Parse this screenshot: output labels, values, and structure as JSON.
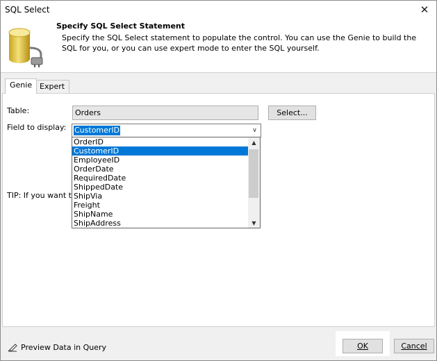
{
  "window": {
    "title": "SQL Select",
    "close_glyph": "✕"
  },
  "header": {
    "title": "Specify SQL Select Statement",
    "description": "Specify the SQL Select statement to populate the control. You can use the Genie to build the SQL for you, or you can use expert mode to enter the SQL yourself."
  },
  "tabs": [
    {
      "label": "Genie",
      "active": true
    },
    {
      "label": "Expert",
      "active": false
    }
  ],
  "form": {
    "table_label": "Table:",
    "table_value": "Orders",
    "select_button": "Select...",
    "field_label": "Field to display:",
    "field_value": "CustomerID",
    "tip_text": "TIP: If you want to"
  },
  "dropdown": {
    "items": [
      "OrderID",
      "CustomerID",
      "EmployeeID",
      "OrderDate",
      "RequiredDate",
      "ShippedDate",
      "ShipVia",
      "Freight",
      "ShipName",
      "ShipAddress"
    ],
    "selected_index": 1
  },
  "footer": {
    "preview_label": "Preview Data in Query",
    "ok_label": "OK",
    "cancel_label": "Cancel"
  },
  "colors": {
    "selection": "#0078d7",
    "background": "#f0f0f0"
  },
  "icons": {
    "header": "database-plug-icon",
    "preview": "preview-pencil-icon",
    "chevron": "chevron-down-icon"
  }
}
